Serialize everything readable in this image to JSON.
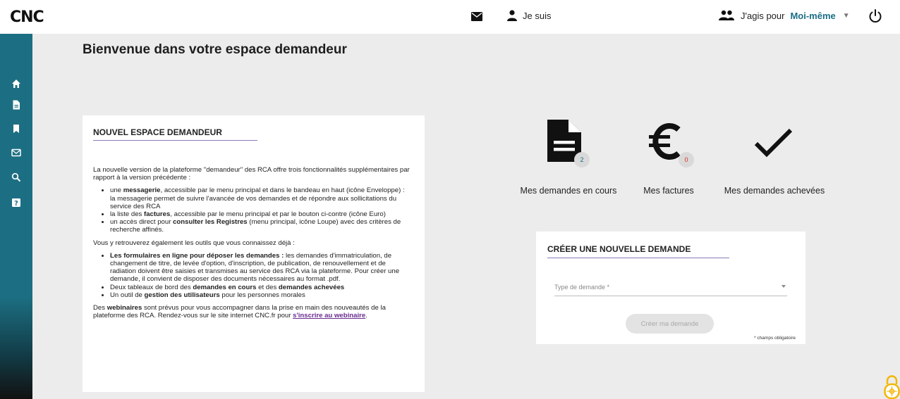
{
  "header": {
    "logo_text": "CNC",
    "user_label": "Je suis",
    "acting_prefix": "J'agis pour",
    "acting_value": "Moi-même",
    "icons": {
      "mail": "envelope-icon",
      "user": "person-icon",
      "group": "people-icon",
      "power": "power-icon",
      "dropdown": "caret-down-icon"
    }
  },
  "sidebar": {
    "items": [
      {
        "icon": "home-icon"
      },
      {
        "icon": "document-icon"
      },
      {
        "icon": "bookmark-icon"
      },
      {
        "icon": "envelope-icon"
      },
      {
        "icon": "search-icon"
      },
      {
        "icon": "help-icon"
      }
    ]
  },
  "page": {
    "title": "Bienvenue dans votre espace demandeur"
  },
  "info": {
    "heading": "NOUVEL ESPACE DEMANDEUR",
    "intro": "La nouvelle version de la plateforme \"demandeur\" des RCA offre trois fonctionnalités supplémentaires par rapport à la version précédente :",
    "features": [
      {
        "pre": "une ",
        "bold": "messagerie",
        "post": ", accessible par le menu principal et dans le bandeau en haut (icône Enveloppe) : la messagerie permet de suivre l'avancée de vos demandes et de répondre aux sollicitations du service des RCA"
      },
      {
        "pre": "la liste des ",
        "bold": "factures",
        "post": ", accessible par le menu principal et par le bouton ci-contre (icône Euro)"
      },
      {
        "pre": "un accès direct pour ",
        "bold": "consulter les Registres",
        "post": " (menu principal, icône Loupe) avec des critères de recherche affinés."
      }
    ],
    "tools_intro": "Vous y retrouverez également les outils que vous connaissez déjà :",
    "tools": [
      {
        "pre": "",
        "bold": "Les formulaires en ligne pour déposer les demandes :",
        "post": " les demandes d'immatriculation, de changement de titre, de levée d'option, d'inscription, de publication, de renouvellement et de radiation doivent être saisies et transmises au service des RCA via la plateforme. Pour créer une demande, il convient de disposer des documents nécessaires au format .pdf."
      },
      {
        "pre": "Deux tableaux de bord des ",
        "bold": "demandes en cours",
        "mid": " et des ",
        "bold2": "demandes achevées",
        "post": ""
      },
      {
        "pre": "Un outil de ",
        "bold": "gestion des utilisateurs",
        "post": " pour les personnes morales"
      }
    ],
    "webinar_pre": "Des ",
    "webinar_bold": "webinaires",
    "webinar_post": " sont prévus pour vous accompagner dans la prise en main des nouveautés de la plateforme des RCA. Rendez-vous sur le site internet CNC.fr pour ",
    "webinar_link": "s'inscrire au webinaire",
    "webinar_end": "."
  },
  "stats": {
    "en_cours": {
      "label": "Mes demandes en cours",
      "count": "2",
      "icon": "document-icon",
      "badge_color": "#1a6f86"
    },
    "factures": {
      "label": "Mes factures",
      "count": "0",
      "icon": "euro-icon",
      "badge_color": "#d93025"
    },
    "achevees": {
      "label": "Mes demandes achevées",
      "icon": "checkmark-icon"
    }
  },
  "create": {
    "heading": "CRÉER UNE NOUVELLE DEMANDE",
    "select_placeholder": "Type de demande *",
    "button_label": "Créer ma demande",
    "required_note": "* champs obligatoire"
  },
  "colors": {
    "accent": "#1a6f86",
    "underline": "#8a7ab8",
    "lock": "#f2b705"
  }
}
